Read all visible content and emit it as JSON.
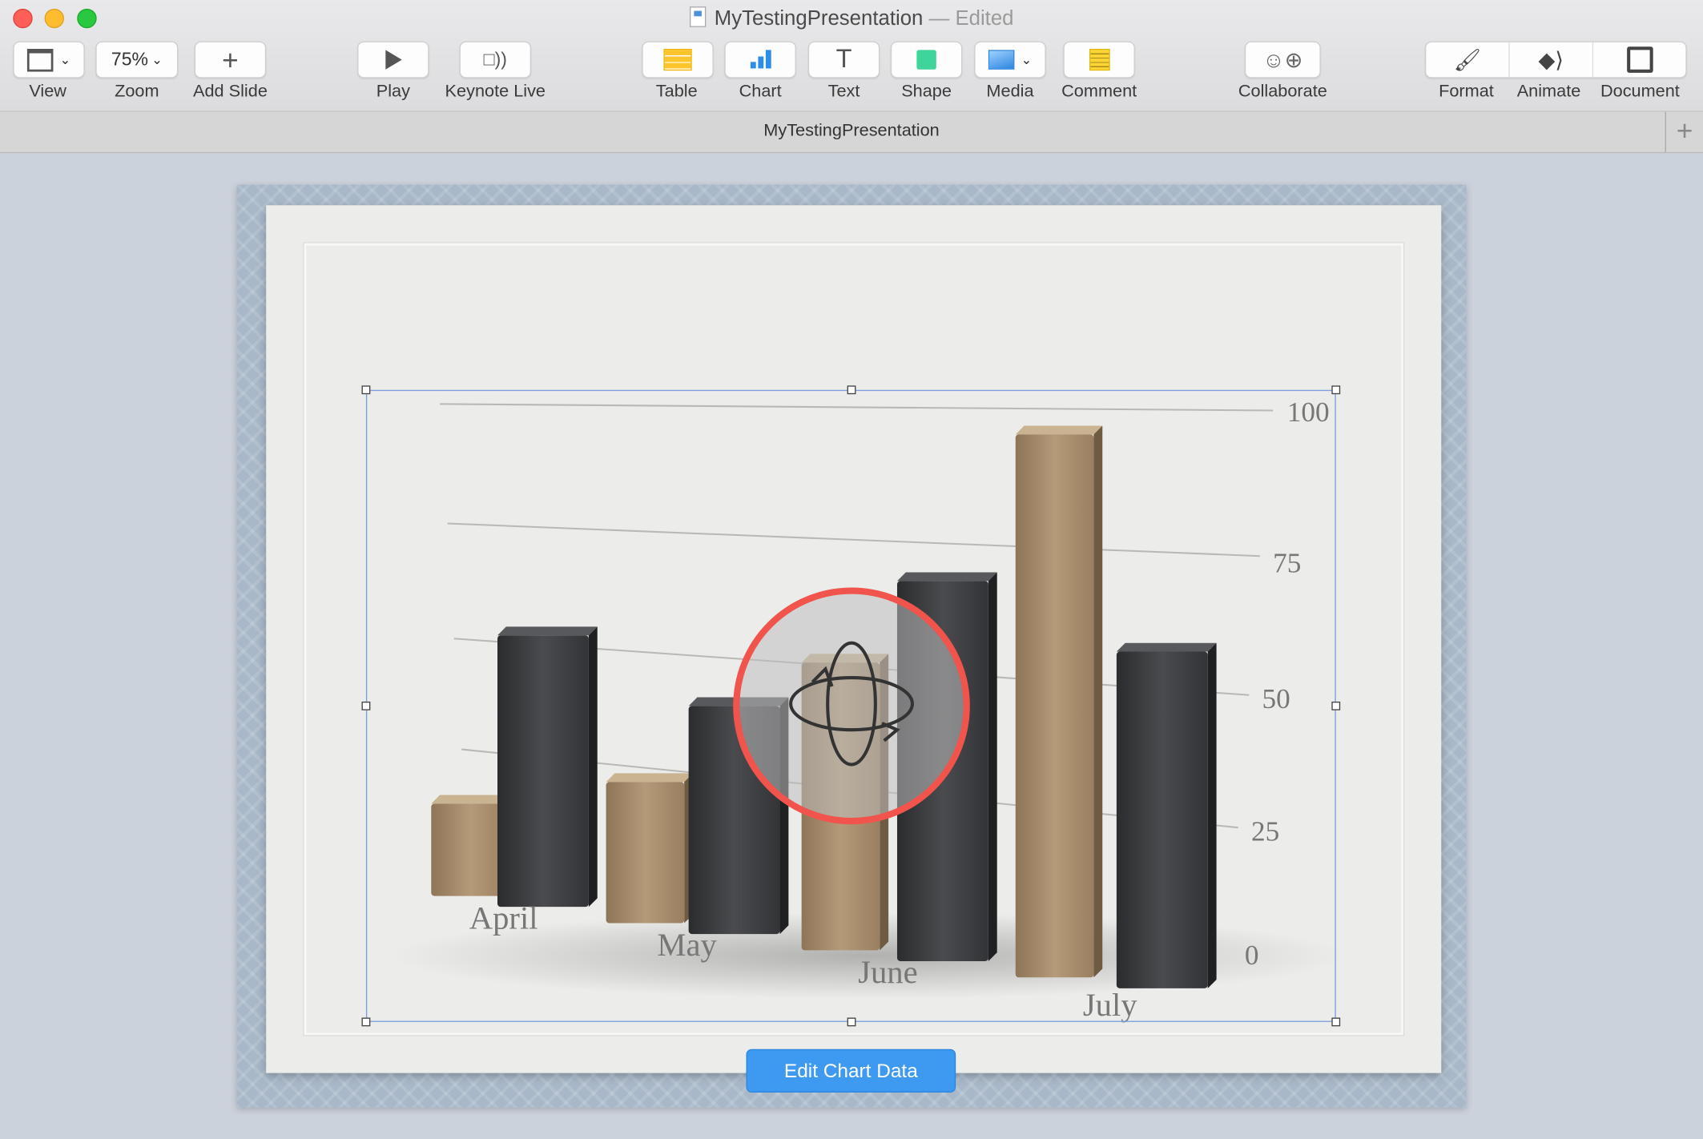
{
  "window": {
    "title": "MyTestingPresentation",
    "status": "— Edited",
    "tab": "MyTestingPresentation"
  },
  "toolbar": {
    "view": "View",
    "zoom_value": "75%",
    "zoom": "Zoom",
    "add_slide": "Add Slide",
    "play": "Play",
    "keynote_live": "Keynote Live",
    "table": "Table",
    "chart": "Chart",
    "text": "Text",
    "shape": "Shape",
    "media": "Media",
    "comment": "Comment",
    "collaborate": "Collaborate",
    "format": "Format",
    "animate": "Animate",
    "document": "Document"
  },
  "edit_chart_button": "Edit Chart Data",
  "colors": {
    "accent": "#3d9af0",
    "rotate_ring": "#f0544c",
    "series_tan": "#a88d6c",
    "series_dark": "#3c3d3f"
  },
  "chart_data": {
    "type": "bar",
    "style": "3d",
    "categories": [
      "April",
      "May",
      "June",
      "July"
    ],
    "series": [
      {
        "values": [
          17,
          26,
          53,
          100
        ]
      },
      {
        "values": [
          50,
          42,
          70,
          62
        ]
      }
    ],
    "yticks": [
      "0",
      "25",
      "50",
      "75",
      "100"
    ],
    "ylim": [
      0,
      100
    ],
    "grid": true
  }
}
